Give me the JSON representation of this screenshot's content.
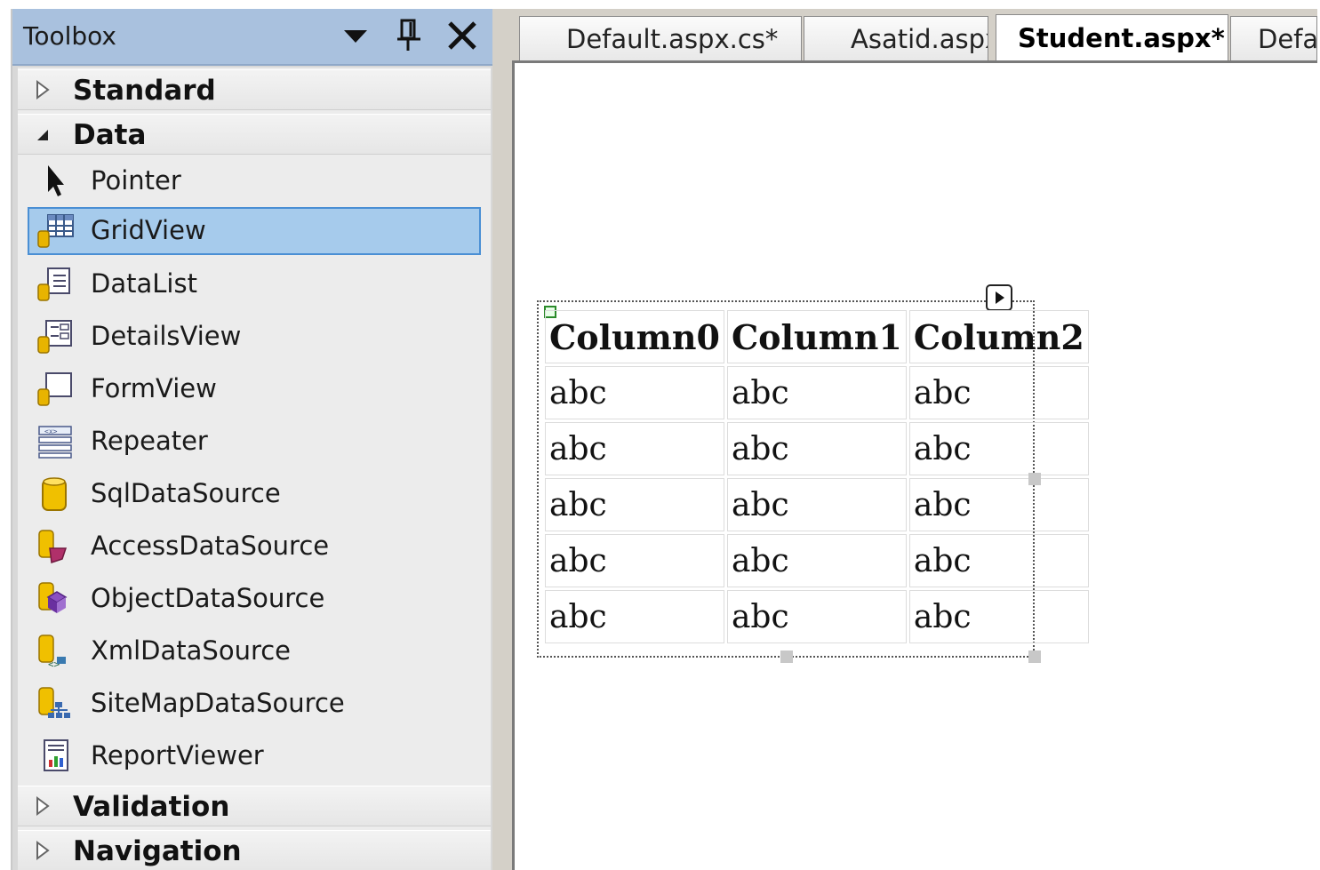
{
  "toolbox": {
    "title": "Toolbox",
    "categories": {
      "standard": "Standard",
      "data": "Data",
      "validation": "Validation",
      "navigation": "Navigation"
    },
    "items": [
      {
        "label": "Pointer",
        "icon": "pointer-icon"
      },
      {
        "label": "GridView",
        "icon": "gridview-icon",
        "selected": true
      },
      {
        "label": "DataList",
        "icon": "datalist-icon"
      },
      {
        "label": "DetailsView",
        "icon": "detailsview-icon"
      },
      {
        "label": "FormView",
        "icon": "formview-icon"
      },
      {
        "label": "Repeater",
        "icon": "repeater-icon"
      },
      {
        "label": "SqlDataSource",
        "icon": "sqldatasource-icon"
      },
      {
        "label": "AccessDataSource",
        "icon": "accessdatasource-icon"
      },
      {
        "label": "ObjectDataSource",
        "icon": "objectdatasource-icon"
      },
      {
        "label": "XmlDataSource",
        "icon": "xmldatasource-icon"
      },
      {
        "label": "SiteMapDataSource",
        "icon": "sitemapdatasource-icon"
      },
      {
        "label": "ReportViewer",
        "icon": "reportviewer-icon"
      }
    ]
  },
  "tabs": [
    {
      "label": "Default.aspx.cs*",
      "active": false
    },
    {
      "label": "Asatid.aspx",
      "active": false
    },
    {
      "label": "Student.aspx*",
      "active": true
    },
    {
      "label": "Defa",
      "active": false
    }
  ],
  "gridview": {
    "headers": [
      "Column0",
      "Column1",
      "Column2"
    ],
    "rows": [
      [
        "abc",
        "abc",
        "abc"
      ],
      [
        "abc",
        "abc",
        "abc"
      ],
      [
        "abc",
        "abc",
        "abc"
      ],
      [
        "abc",
        "abc",
        "abc"
      ],
      [
        "abc",
        "abc",
        "abc"
      ]
    ]
  },
  "colors": {
    "title_bar": "#a9c1de",
    "selection": "#a6cbec",
    "selection_border": "#4a8fd4"
  }
}
